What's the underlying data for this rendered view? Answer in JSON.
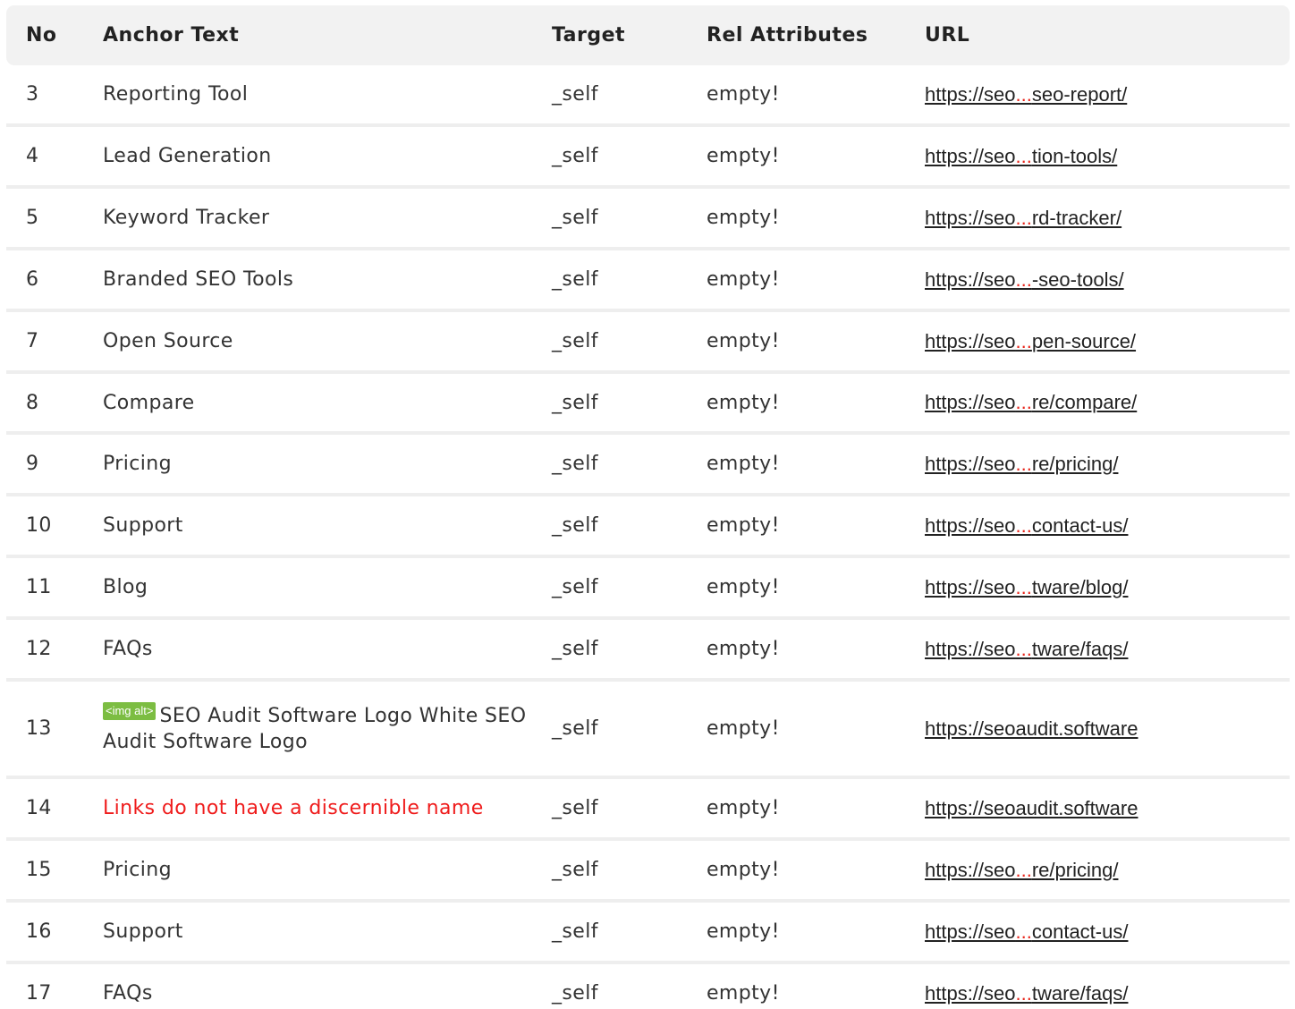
{
  "headers": {
    "no": "No",
    "anchor_text": "Anchor Text",
    "target": "Target",
    "rel": "Rel Attributes",
    "url": "URL"
  },
  "colors": {
    "header_bg": "#f2f2f2",
    "ellipsis": "#e8251b",
    "warning_text": "#ef1c1c",
    "img_alt_badge": "#7cbd42"
  },
  "rows": [
    {
      "no": "3",
      "anchor": "Reporting Tool",
      "target": "_self",
      "rel": "empty!",
      "url_start": "https://seo",
      "url_ellipsis": "...",
      "url_end": "seo-report/"
    },
    {
      "no": "4",
      "anchor": "Lead Generation",
      "target": "_self",
      "rel": "empty!",
      "url_start": "https://seo",
      "url_ellipsis": "...",
      "url_end": "tion-tools/"
    },
    {
      "no": "5",
      "anchor": "Keyword Tracker",
      "target": "_self",
      "rel": "empty!",
      "url_start": "https://seo",
      "url_ellipsis": "...",
      "url_end": "rd-tracker/"
    },
    {
      "no": "6",
      "anchor": "Branded SEO Tools",
      "target": "_self",
      "rel": "empty!",
      "url_start": "https://seo",
      "url_ellipsis": "...",
      "url_end": "-seo-tools/"
    },
    {
      "no": "7",
      "anchor": "Open Source",
      "target": "_self",
      "rel": "empty!",
      "url_start": "https://seo",
      "url_ellipsis": "...",
      "url_end": "pen-source/"
    },
    {
      "no": "8",
      "anchor": "Compare",
      "target": "_self",
      "rel": "empty!",
      "url_start": "https://seo",
      "url_ellipsis": "...",
      "url_end": "re/compare/"
    },
    {
      "no": "9",
      "anchor": "Pricing",
      "target": "_self",
      "rel": "empty!",
      "url_start": "https://seo",
      "url_ellipsis": "...",
      "url_end": "re/pricing/"
    },
    {
      "no": "10",
      "anchor": "Support",
      "target": "_self",
      "rel": "empty!",
      "url_start": "https://seo",
      "url_ellipsis": "...",
      "url_end": "contact-us/"
    },
    {
      "no": "11",
      "anchor": "Blog",
      "target": "_self",
      "rel": "empty!",
      "url_start": "https://seo",
      "url_ellipsis": "...",
      "url_end": "tware/blog/"
    },
    {
      "no": "12",
      "anchor": "FAQs",
      "target": "_self",
      "rel": "empty!",
      "url_start": "https://seo",
      "url_ellipsis": "...",
      "url_end": "tware/faqs/"
    },
    {
      "no": "13",
      "anchor_badge": "<img alt>",
      "anchor": "SEO Audit Software Logo White SEO Audit Software Logo",
      "target": "_self",
      "rel": "empty!",
      "url_full": "https://seoaudit.software"
    },
    {
      "no": "14",
      "anchor_warning": "Links do not have a discernible name",
      "target": "_self",
      "rel": "empty!",
      "url_full": "https://seoaudit.software"
    },
    {
      "no": "15",
      "anchor": "Pricing",
      "target": "_self",
      "rel": "empty!",
      "url_start": "https://seo",
      "url_ellipsis": "...",
      "url_end": "re/pricing/"
    },
    {
      "no": "16",
      "anchor": "Support",
      "target": "_self",
      "rel": "empty!",
      "url_start": "https://seo",
      "url_ellipsis": "...",
      "url_end": "contact-us/"
    },
    {
      "no": "17",
      "anchor": "FAQs",
      "target": "_self",
      "rel": "empty!",
      "url_start": "https://seo",
      "url_ellipsis": "...",
      "url_end": "tware/faqs/"
    }
  ]
}
